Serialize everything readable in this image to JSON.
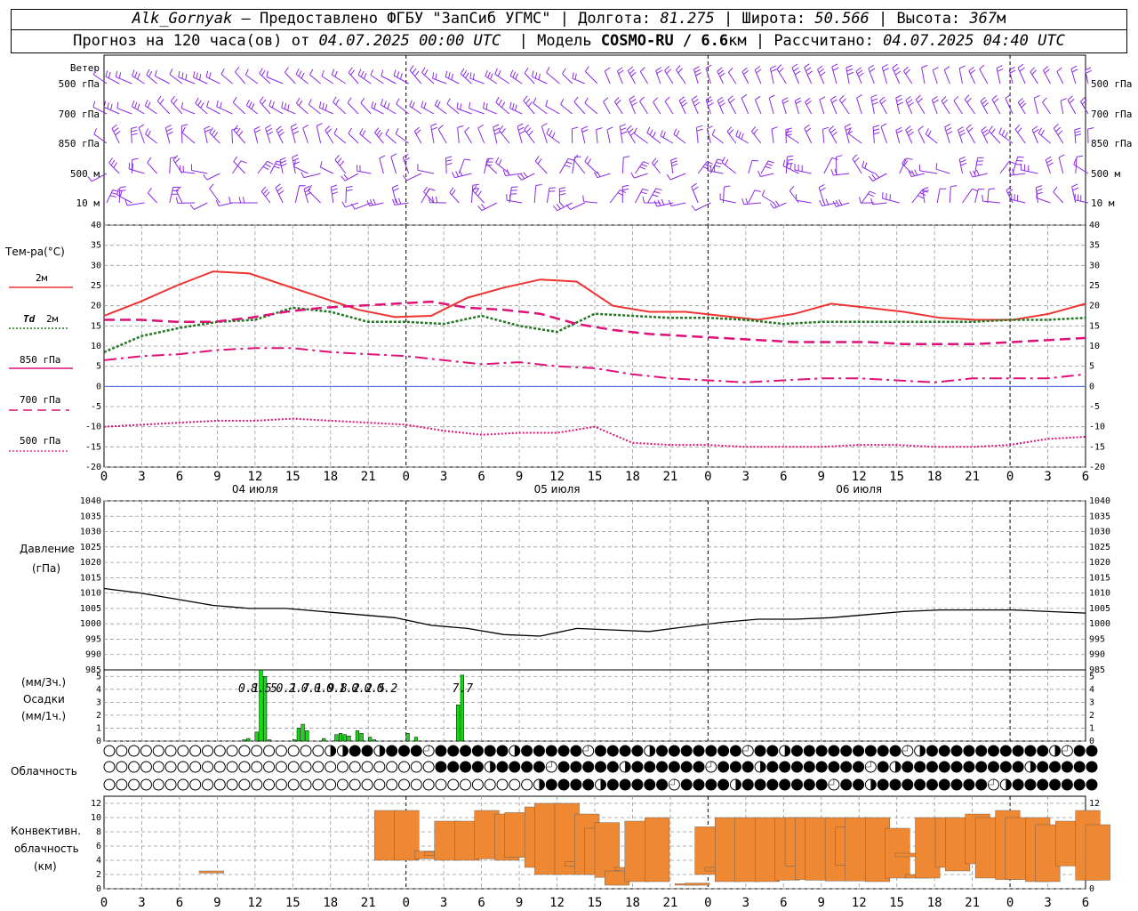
{
  "header": {
    "station": "Alk_Gornyak",
    "dash": "—",
    "provider": "Предоставлено ФГБУ \"ЗапСиб УГМС\"",
    "lon_label": "Долгота:",
    "lon": "81.275",
    "lat_label": "Широта:",
    "lat": "50.566",
    "alt_label": "Высота:",
    "alt": "367",
    "alt_unit": "м",
    "forecast_label": "Прогноз на 120 часа(ов) от",
    "forecast_from": "04.07.2025 00:00 UTC",
    "model_label": "Модель",
    "model": "COSMO-RU / 6.6",
    "model_unit": "км",
    "calc_label": "Рассчитано:",
    "calc_time": "04.07.2025 04:40 UTC"
  },
  "chart_data": [
    {
      "id": "wind",
      "type": "wind-barbs",
      "title": "Ветер",
      "levels": [
        "500 гПа",
        "700 гПа",
        "850 гПа",
        "500 м",
        "10  м"
      ],
      "color": "#8a2be2",
      "step_hours": 1
    },
    {
      "id": "temperature",
      "type": "line",
      "ylabel": "Тем-ра(°С)",
      "ylim": [
        -20,
        40
      ],
      "yticks": [
        40,
        35,
        30,
        25,
        20,
        15,
        10,
        5,
        0,
        -5,
        -10,
        -15,
        -20
      ],
      "x_hours": [
        0,
        3,
        6,
        9,
        12,
        15,
        18,
        21,
        24,
        27,
        30,
        33,
        36,
        39,
        42,
        45,
        48,
        51,
        54,
        57,
        60,
        63,
        66,
        69,
        72,
        75,
        78
      ],
      "series": [
        {
          "name": "2м",
          "color": "#ee3333",
          "style": "solid",
          "values": [
            17.5,
            21,
            25,
            28.5,
            28,
            25,
            22,
            19,
            17.2,
            17.5,
            22,
            24.5,
            26.5,
            26,
            20,
            18.5,
            18.5,
            17.5,
            16.5,
            18,
            20.5,
            19.5,
            18.5,
            17,
            16.5,
            16.5,
            18,
            20.5
          ]
        },
        {
          "name": "Td 2м",
          "color": "#227722",
          "style": "dotted",
          "values": [
            8.5,
            12.5,
            14.5,
            16,
            16.5,
            19.5,
            18.5,
            16,
            16,
            15.5,
            17.5,
            15,
            13.5,
            18,
            17.5,
            17,
            17,
            16.5,
            15.5,
            16,
            16,
            16,
            16,
            16,
            16.5,
            16.5,
            17
          ]
        },
        {
          "name": "850 гПа",
          "color": "#dd1177",
          "style": "dashdot",
          "values": [
            6.5,
            7.5,
            8,
            9,
            9.5,
            9.5,
            8.5,
            8,
            7.5,
            6.5,
            5.5,
            6,
            5,
            4.5,
            3,
            2,
            1.5,
            1,
            1.5,
            2,
            2,
            1.5,
            1,
            2,
            2,
            2,
            3
          ]
        },
        {
          "name": "700 гПа",
          "color": "#dd1177",
          "style": "longdash",
          "values": [
            16.5,
            16.5,
            16,
            16,
            17,
            18.5,
            19.5,
            20,
            20.5,
            21,
            19.5,
            19,
            18,
            15.5,
            14,
            13,
            12.5,
            12,
            11.5,
            11,
            11,
            11,
            10.5,
            10.5,
            10.5,
            11,
            11.5,
            12
          ]
        },
        {
          "name": "500 гПа",
          "color": "#dd1177",
          "style": "dotted-fine",
          "values": [
            -10,
            -9.5,
            -9,
            -8.5,
            -8.5,
            -8,
            -8.5,
            -9,
            -9.5,
            -11,
            -12,
            -11.5,
            -11.5,
            -10,
            -14,
            -14.5,
            -14.5,
            -15,
            -15,
            -15,
            -14.5,
            -14.5,
            -15,
            -15,
            -14.5,
            -13,
            -12.5
          ]
        }
      ]
    },
    {
      "id": "pressure",
      "type": "line",
      "ylabel": "Давление",
      "yunit": "(гПа)",
      "ylim": [
        985,
        1040
      ],
      "yticks": [
        1040,
        1035,
        1030,
        1025,
        1020,
        1015,
        1010,
        1005,
        1000,
        995,
        990,
        985
      ],
      "series": [
        {
          "name": "Давление",
          "color": "#000000",
          "values": [
            1011.5,
            1010,
            1008,
            1006,
            1005,
            1005,
            1004,
            1003,
            1002,
            999.5,
            998.5,
            996.5,
            996,
            998.5,
            998,
            997.5,
            999,
            1000.5,
            1001.5,
            1001.5,
            1002,
            1003,
            1004,
            1004.5,
            1004.5,
            1004.5,
            1004,
            1003.5
          ]
        }
      ]
    },
    {
      "id": "precip",
      "type": "bar",
      "ylabel_top": "(мм/3ч.)",
      "ylabel_mid": "Осадки",
      "ylabel_bot": "(мм/1ч.)",
      "ylim": [
        0,
        5.5
      ],
      "yticks": [
        5,
        4,
        3,
        2,
        1,
        0
      ],
      "color": "#11dd11",
      "hourly_bars": [
        [
          33,
          0.1
        ],
        [
          34,
          0.2
        ],
        [
          36,
          0.7
        ],
        [
          37,
          5.5
        ],
        [
          38,
          5
        ],
        [
          39,
          0.1
        ],
        [
          45,
          0.1
        ],
        [
          46,
          1
        ],
        [
          47,
          1.3
        ],
        [
          48,
          0.8
        ],
        [
          52,
          0.2
        ],
        [
          55,
          0.5
        ],
        [
          56,
          0.6
        ],
        [
          57,
          0.5
        ],
        [
          58,
          0.4
        ],
        [
          60,
          0.8
        ],
        [
          61,
          0.6
        ],
        [
          63,
          0.3
        ],
        [
          64,
          0.1
        ],
        [
          72,
          0.6
        ],
        [
          74,
          0.3
        ],
        [
          84,
          2.8
        ],
        [
          85,
          5.1
        ]
      ],
      "sums_3h": [
        {
          "hour": 33,
          "label": "0.1"
        },
        {
          "hour": 36,
          "label": "8.5"
        },
        {
          "hour": 39,
          "label": "5"
        },
        {
          "hour": 42,
          "label": "0.1"
        },
        {
          "hour": 45,
          "label": "2.7"
        },
        {
          "hour": 48,
          "label": "0.1"
        },
        {
          "hour": 51,
          "label": "0.9"
        },
        {
          "hour": 54,
          "label": "0.8"
        },
        {
          "hour": 57,
          "label": "1.2"
        },
        {
          "hour": 60,
          "label": "0.2"
        },
        {
          "hour": 63,
          "label": "0.5"
        },
        {
          "hour": 66,
          "label": "0.2"
        },
        {
          "hour": 84,
          "label": "7.7"
        }
      ]
    },
    {
      "id": "clouds",
      "type": "cloud-symbols",
      "ylabel": "Облачность",
      "rows": [
        {
          "level": "upper",
          "empty_until": 18,
          "transition": [
            18,
            20
          ],
          "full_from": 20
        },
        {
          "level": "middle",
          "empty_until": 27,
          "transition": [
            27,
            27
          ],
          "full_from": 27
        },
        {
          "level": "lower",
          "empty_until": 35,
          "transition": [
            35,
            36
          ],
          "full_from": 36
        }
      ]
    },
    {
      "id": "convective",
      "type": "range-bar",
      "ylabel": "Конвективн.",
      "ylabel2": "облачность",
      "ylabel3": "(км)",
      "ylim": [
        0,
        13
      ],
      "yticks": [
        12,
        10,
        8,
        6,
        4,
        2,
        0
      ],
      "color": "#ee8833",
      "bars": [
        [
          9.5,
          2.2,
          2.5
        ],
        [
          27,
          4,
          11
        ],
        [
          29,
          4,
          11
        ],
        [
          31,
          4.2,
          5.3
        ],
        [
          32,
          4.7,
          5.2
        ],
        [
          33,
          4,
          9.5
        ],
        [
          35,
          4,
          9.5
        ],
        [
          37,
          4.2,
          11
        ],
        [
          39,
          4,
          10.5
        ],
        [
          40,
          4.4,
          10.7
        ],
        [
          42,
          3,
          11.5
        ],
        [
          43,
          2,
          12
        ],
        [
          45,
          2,
          12
        ],
        [
          46,
          3.2,
          3.8
        ],
        [
          47,
          2,
          10.5
        ],
        [
          48,
          2,
          8.5
        ],
        [
          49,
          1.6,
          9.3
        ],
        [
          50,
          0.5,
          2.5
        ],
        [
          51,
          2.6,
          3
        ],
        [
          52,
          1,
          9.5
        ],
        [
          54,
          1,
          10
        ],
        [
          57,
          0.5,
          0.7
        ],
        [
          58,
          0.5,
          0.8
        ],
        [
          59,
          2,
          8.7
        ],
        [
          60,
          2.5,
          3
        ],
        [
          61,
          1,
          10
        ],
        [
          63,
          1,
          10
        ],
        [
          65,
          1,
          10
        ],
        [
          67,
          1.2,
          10
        ],
        [
          68,
          3.2,
          10
        ],
        [
          69,
          1.3,
          10
        ],
        [
          70,
          1.2,
          10
        ],
        [
          72,
          1.1,
          10
        ],
        [
          73,
          3.3,
          8.7
        ],
        [
          74,
          1.1,
          10
        ],
        [
          76,
          1,
          10
        ],
        [
          78,
          1.5,
          8.5
        ],
        [
          79,
          4.5,
          5
        ],
        [
          80,
          1.5,
          2
        ],
        [
          81,
          1.5,
          10
        ],
        [
          83,
          3,
          10
        ],
        [
          84,
          2.5,
          10
        ],
        [
          86,
          3.5,
          10.5
        ],
        [
          87,
          1.5,
          10
        ],
        [
          89,
          1.3,
          11
        ],
        [
          90,
          1.3,
          10
        ],
        [
          92,
          1,
          10
        ],
        [
          93,
          1,
          9
        ],
        [
          95,
          3.2,
          9.5
        ],
        [
          97,
          1.2,
          11
        ],
        [
          98,
          1.2,
          9
        ]
      ]
    }
  ],
  "axis": {
    "hour_labels": [
      "0",
      "3",
      "6",
      "9",
      "12",
      "15",
      "18",
      "21",
      "0",
      "3",
      "6",
      "9",
      "12",
      "15",
      "18",
      "21",
      "0",
      "3",
      "6",
      "9",
      "12",
      "15",
      "18",
      "21",
      "0",
      "3",
      "6"
    ],
    "day_labels": [
      {
        "hour": 12,
        "label": "04 июля"
      },
      {
        "hour": 36,
        "label": "05 июля"
      },
      {
        "hour": 60,
        "label": "06 июля"
      }
    ]
  },
  "legend": {
    "t2m": "2м",
    "td_label": "Td",
    "td_level": "2м",
    "t850": "850 гПа",
    "t700": "700 гПа",
    "t500": "500 гПа"
  }
}
